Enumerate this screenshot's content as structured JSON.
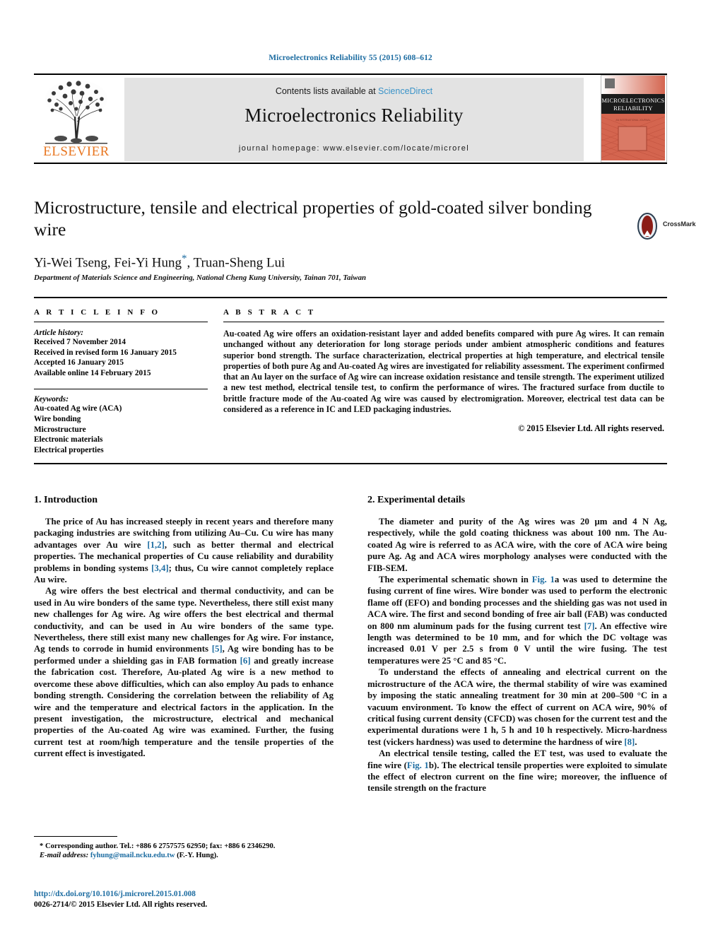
{
  "running_head": "Microelectronics Reliability 55 (2015) 608–612",
  "masthead": {
    "contents_prefix": "Contents lists available at ",
    "sciencedirect": "ScienceDirect",
    "journal_title": "Microelectronics Reliability",
    "homepage": "journal homepage: www.elsevier.com/locate/microrel",
    "publisher": "ELSEVIER",
    "cover_line1": "MICROELECTRONICS",
    "cover_line2": "RELIABILITY",
    "link_color": "#3a93c8",
    "elsevier_color": "#E87722"
  },
  "article": {
    "title": "Microstructure, tensile and electrical properties of gold-coated silver bonding wire",
    "authors_pre": "Yi-Wei Tseng, Fei-Yi Hung",
    "author_star": "*",
    "authors_post": ", Truan-Sheng Lui",
    "affiliation": "Department of Materials Science and Engineering, National Cheng Kung University, Tainan 701, Taiwan",
    "crossmark_label": "CrossMark"
  },
  "article_info": {
    "heading": "A R T I C L E    I N F O",
    "history_label": "Article history:",
    "history": [
      "Received 7 November 2014",
      "Received in revised form 16 January 2015",
      "Accepted 16 January 2015",
      "Available online 14 February 2015"
    ],
    "keywords_label": "Keywords:",
    "keywords": [
      "Au-coated Ag wire (ACA)",
      "Wire bonding",
      "Microstructure",
      "Electronic materials",
      "Electrical properties"
    ]
  },
  "abstract": {
    "heading": "A B S T R A C T",
    "text": "Au-coated Ag wire offers an oxidation-resistant layer and added benefits compared with pure Ag wires. It can remain unchanged without any deterioration for long storage periods under ambient atmospheric conditions and features superior bond strength. The surface characterization, electrical properties at high temperature, and electrical tensile properties of both pure Ag and Au-coated Ag wires are investigated for reliability assessment. The experiment confirmed that an Au layer on the surface of Ag wire can increase oxidation resistance and tensile strength. The experiment utilized a new test method, electrical tensile test, to confirm the performance of wires. The fractured surface from ductile to brittle fracture mode of the Au-coated Ag wire was caused by electromigration. Moreover, electrical test data can be considered as a reference in IC and LED packaging industries.",
    "copyright": "© 2015 Elsevier Ltd. All rights reserved."
  },
  "sections": {
    "introduction": {
      "heading": "1. Introduction",
      "paragraphs": [
        {
          "parts": [
            {
              "t": "The price of Au has increased steeply in recent years and therefore many packaging industries are switching from utilizing Au–Cu. Cu wire has many advantages over Au wire "
            },
            {
              "t": "[1,2]",
              "ref": true
            },
            {
              "t": ", such as better thermal and electrical properties. The mechanical properties of Cu cause reliability and durability problems in bonding systems "
            },
            {
              "t": "[3,4]",
              "ref": true
            },
            {
              "t": "; thus, Cu wire cannot completely replace Au wire."
            }
          ]
        },
        {
          "parts": [
            {
              "t": "Ag wire offers the best electrical and thermal conductivity, and can be used in Au wire bonders of the same type. Nevertheless, there still exist many new challenges for Ag wire. Ag wire offers the best electrical and thermal conductivity, and can be used in Au wire bonders of the same type. Nevertheless, there still exist many new challenges for Ag wire. For instance, Ag tends to corrode in humid environments "
            },
            {
              "t": "[5]",
              "ref": true
            },
            {
              "t": ", Ag wire bonding has to be performed under a shielding gas in FAB formation "
            },
            {
              "t": "[6]",
              "ref": true
            },
            {
              "t": " and greatly increase the fabrication cost. Therefore, Au-plated Ag wire is a new method to overcome these above difficulties, which can also employ Au pads to enhance bonding strength. Considering the correlation between the reliability of Ag wire and the temperature and electrical factors in the application. In the present investigation, the microstructure, electrical and mechanical properties of the Au-coated Ag wire was examined. Further, the fusing current test at room/high temperature and the tensile properties of the current effect is investigated."
            }
          ]
        }
      ]
    },
    "experimental": {
      "heading": "2. Experimental details",
      "paragraphs": [
        {
          "parts": [
            {
              "t": "The diameter and purity of the Ag wires was 20 μm and 4 N Ag, respectively, while the gold coating thickness was about 100 nm. The Au-coated Ag wire is referred to as ACA wire, with the core of ACA wire being pure Ag. Ag and ACA wires morphology analyses were conducted with the FIB-SEM."
            }
          ]
        },
        {
          "parts": [
            {
              "t": "The experimental schematic shown in "
            },
            {
              "t": "Fig. 1",
              "ref": true
            },
            {
              "t": "a was used to determine the fusing current of fine wires. Wire bonder was used to perform the electronic flame off (EFO) and bonding processes and the shielding gas was not used in ACA wire. The first and second bonding of free air ball (FAB) was conducted on 800 nm aluminum pads for the fusing current test "
            },
            {
              "t": "[7]",
              "ref": true
            },
            {
              "t": ". An effective wire length was determined to be 10 mm, and for which the DC voltage was increased 0.01 V per 2.5 s from 0 V until the wire fusing. The test temperatures were 25 °C and 85 °C."
            }
          ]
        },
        {
          "parts": [
            {
              "t": "To understand the effects of annealing and electrical current on the microstructure of the ACA wire, the thermal stability of wire was examined by imposing the static annealing treatment for 30 min at 200–500 °C in a vacuum environment. To know the effect of current on ACA wire, 90% of critical fusing current density (CFCD) was chosen for the current test and the experimental durations were 1 h, 5 h and 10 h respectively. Micro-hardness test (vickers hardness) was used to determine the hardness of wire "
            },
            {
              "t": "[8]",
              "ref": true
            },
            {
              "t": "."
            }
          ]
        },
        {
          "parts": [
            {
              "t": "An electrical tensile testing, called the ET test, was used to evaluate the fine wire ("
            },
            {
              "t": "Fig. 1",
              "ref": true
            },
            {
              "t": "b). The electrical tensile properties were exploited to simulate the effect of electron current on the fine wire; moreover, the influence of tensile strength on the fracture"
            }
          ]
        }
      ]
    }
  },
  "footnote": {
    "star": "*",
    "corresponding": "Corresponding author. Tel.: +886 6 2757575 62950; fax: +886 6 2346290.",
    "email_label": "E-mail address:",
    "email": "fyhung@mail.ncku.edu.tw",
    "email_owner": "(F.-Y. Hung)."
  },
  "doi_block": {
    "doi": "http://dx.doi.org/10.1016/j.microrel.2015.01.008",
    "issn": "0026-2714/© 2015 Elsevier Ltd. All rights reserved."
  }
}
